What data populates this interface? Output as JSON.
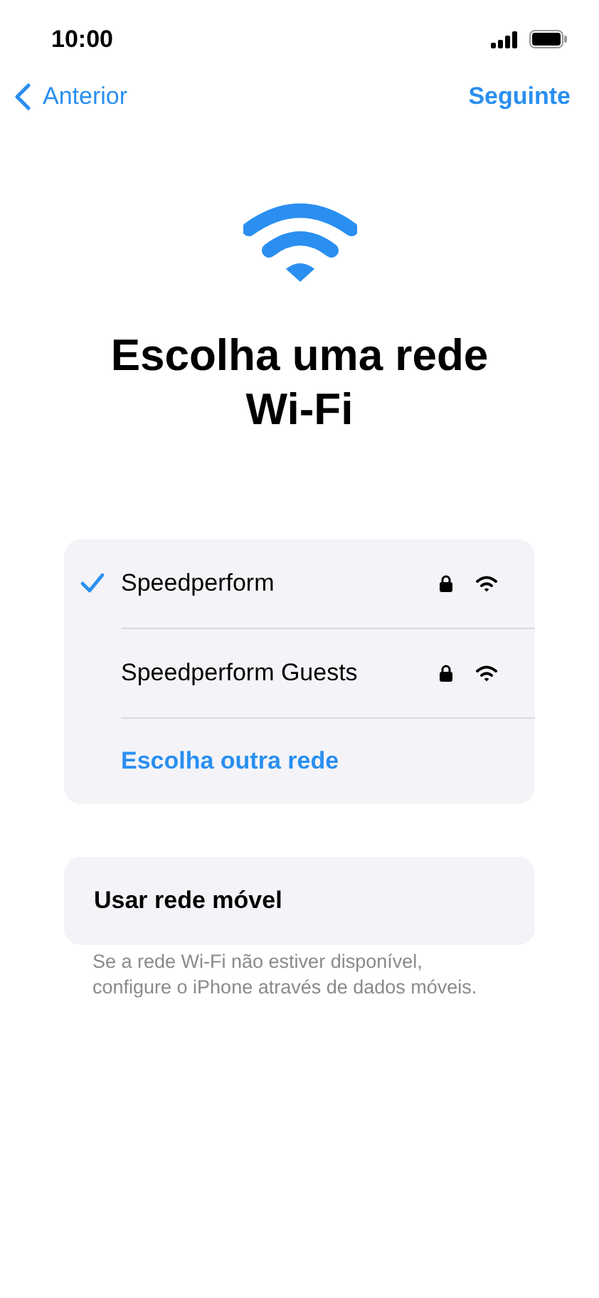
{
  "status_bar": {
    "time": "10:00"
  },
  "nav": {
    "back": "Anterior",
    "next": "Seguinte"
  },
  "title": "Escolha uma rede Wi-Fi",
  "networks": [
    {
      "name": "Speedperform",
      "selected": true,
      "locked": true
    },
    {
      "name": "Speedperform Guests",
      "selected": false,
      "locked": true
    }
  ],
  "other_network": "Escolha outra rede",
  "mobile": {
    "label": "Usar rede móvel",
    "note": "Se a rede Wi-Fi não estiver disponível, configure o iPhone através de dados móveis."
  }
}
